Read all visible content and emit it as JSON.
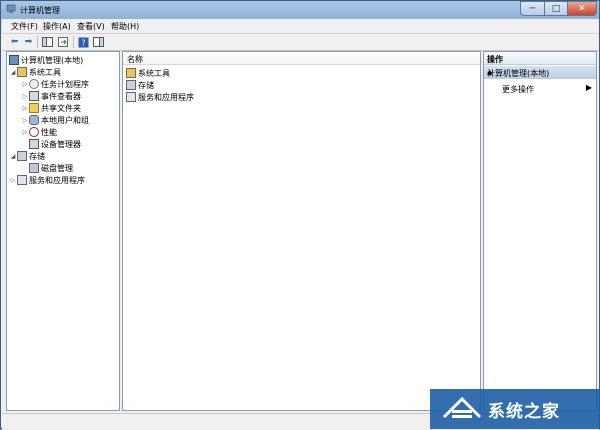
{
  "window": {
    "title": "计算机管理"
  },
  "menubar": [
    {
      "label": "文件(F)"
    },
    {
      "label": "操作(A)"
    },
    {
      "label": "查看(V)"
    },
    {
      "label": "帮助(H)"
    }
  ],
  "tree": {
    "root": "计算机管理(本地)",
    "items": [
      {
        "label": "系统工具"
      },
      {
        "label": "任务计划程序"
      },
      {
        "label": "事件查看器"
      },
      {
        "label": "共享文件夹"
      },
      {
        "label": "本地用户和组"
      },
      {
        "label": "性能"
      },
      {
        "label": "设备管理器"
      },
      {
        "label": "存储"
      },
      {
        "label": "磁盘管理"
      },
      {
        "label": "服务和应用程序"
      }
    ]
  },
  "center": {
    "column_header": "名称",
    "rows": [
      {
        "label": "系统工具"
      },
      {
        "label": "存储"
      },
      {
        "label": "服务和应用程序"
      }
    ]
  },
  "actions": {
    "header": "操作",
    "group": "计算机管理(本地)",
    "item": "更多操作"
  },
  "watermark": {
    "text": "系统之家"
  }
}
